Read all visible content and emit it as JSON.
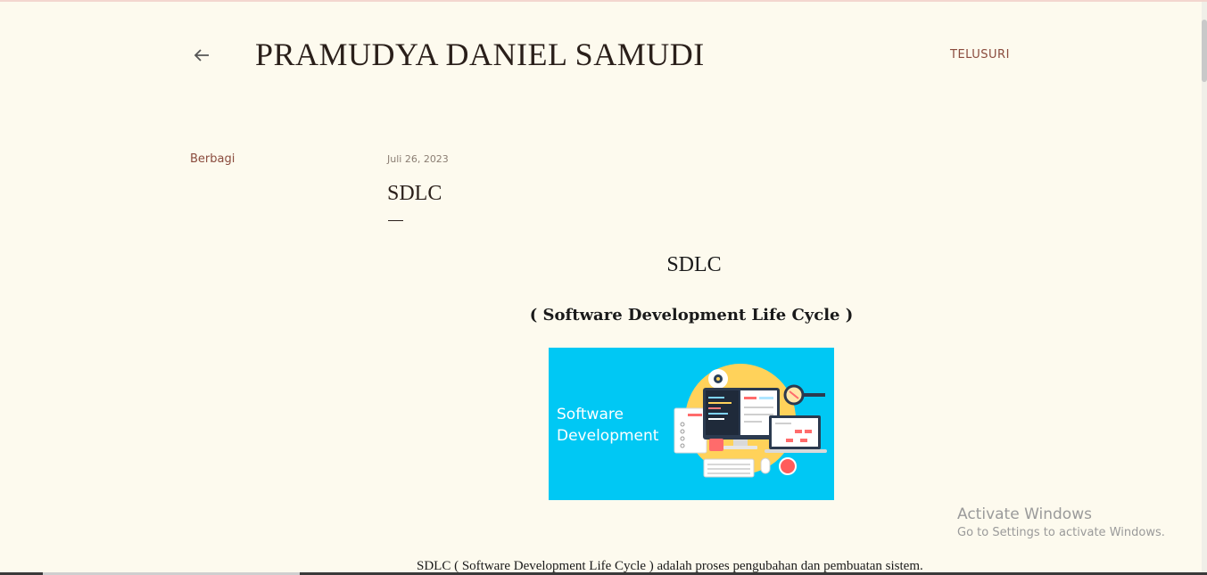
{
  "header": {
    "back_icon": "arrow-left-icon",
    "blog_title": "PRAMUDYA DANIEL SAMUDI",
    "search_label": "TELUSURI"
  },
  "sidebar": {
    "share_label": "Berbagi"
  },
  "post": {
    "date": "Juli 26, 2023",
    "title": "SDLC",
    "heading": "SDLC",
    "subheading": "( Software Development Life Cycle )",
    "image": {
      "text_line1": "Software",
      "text_line2": "Development"
    },
    "paragraph": "SDLC ( Software Development Life Cycle ) adalah proses pengubahan dan pembuatan sistem."
  },
  "watermark": {
    "line1": "Activate Windows",
    "line2": "Go to Settings to activate Windows."
  },
  "colors": {
    "background": "#fdfaee",
    "accent": "#8a4b3d",
    "image_bg": "#00c8f4"
  }
}
